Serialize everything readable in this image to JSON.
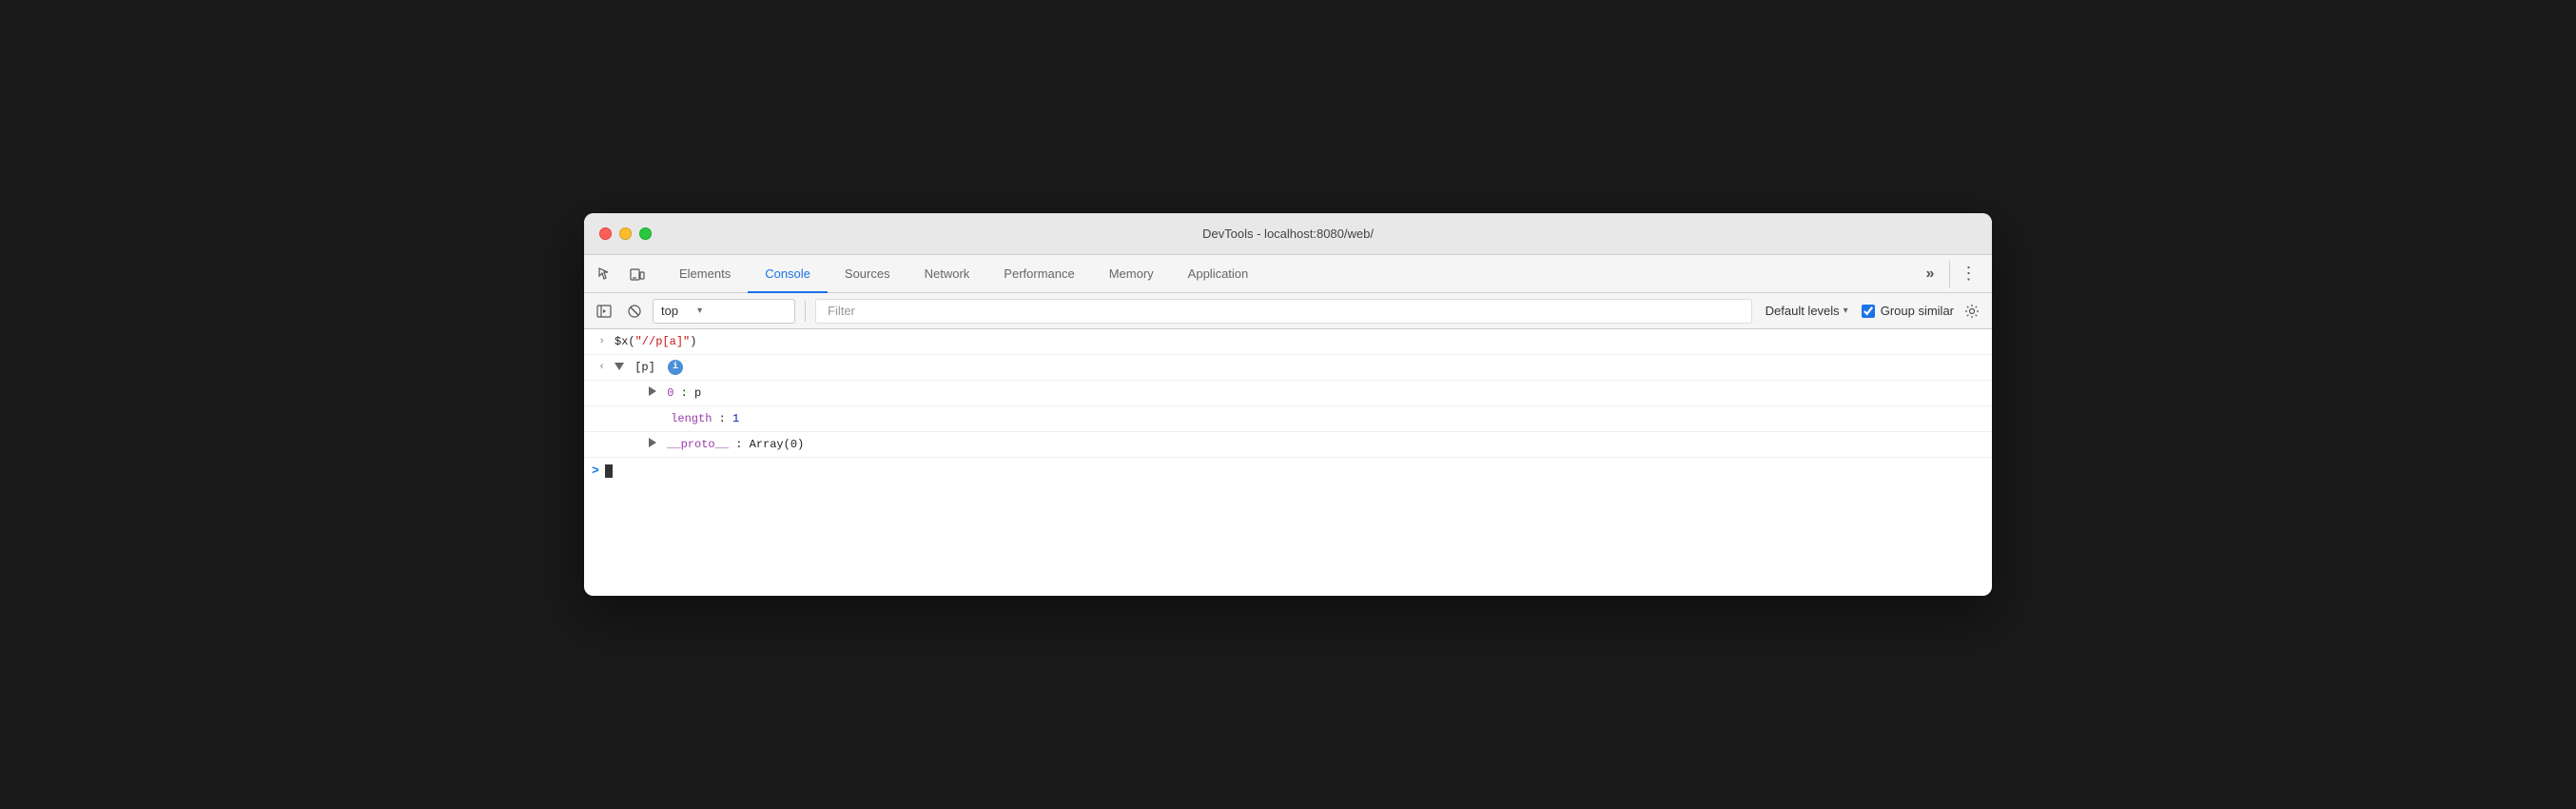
{
  "window": {
    "title": "DevTools - localhost:8080/web/"
  },
  "tabs": {
    "items": [
      {
        "id": "elements",
        "label": "Elements",
        "active": false
      },
      {
        "id": "console",
        "label": "Console",
        "active": true
      },
      {
        "id": "sources",
        "label": "Sources",
        "active": false
      },
      {
        "id": "network",
        "label": "Network",
        "active": false
      },
      {
        "id": "performance",
        "label": "Performance",
        "active": false
      },
      {
        "id": "memory",
        "label": "Memory",
        "active": false
      },
      {
        "id": "application",
        "label": "Application",
        "active": false
      }
    ],
    "more_label": "»",
    "kebab_label": "⋮"
  },
  "toolbar": {
    "top_context": "top",
    "filter_placeholder": "Filter",
    "default_levels_label": "Default levels",
    "group_similar_label": "Group similar",
    "group_similar_checked": true
  },
  "console_lines": [
    {
      "type": "input",
      "gutter": ">",
      "content": "$x(\"//p[a]\")"
    },
    {
      "type": "output",
      "gutter": "<",
      "indent": 0,
      "expanded": true,
      "label": "[p]",
      "has_info": true
    },
    {
      "type": "item",
      "indent": 1,
      "key": "0",
      "value": "p",
      "expandable": true
    },
    {
      "type": "prop",
      "indent": 2,
      "key": "length",
      "value": "1"
    },
    {
      "type": "item",
      "indent": 1,
      "key": "__proto__",
      "value": "Array(0)",
      "expandable": true
    }
  ],
  "prompt": ">",
  "colors": {
    "active_tab": "#1a73e8",
    "string": "#c41a16",
    "purple": "#9b3cac",
    "blue": "#0d22aa",
    "info_badge": "#4a90d9",
    "prompt": "#1a73e8"
  }
}
